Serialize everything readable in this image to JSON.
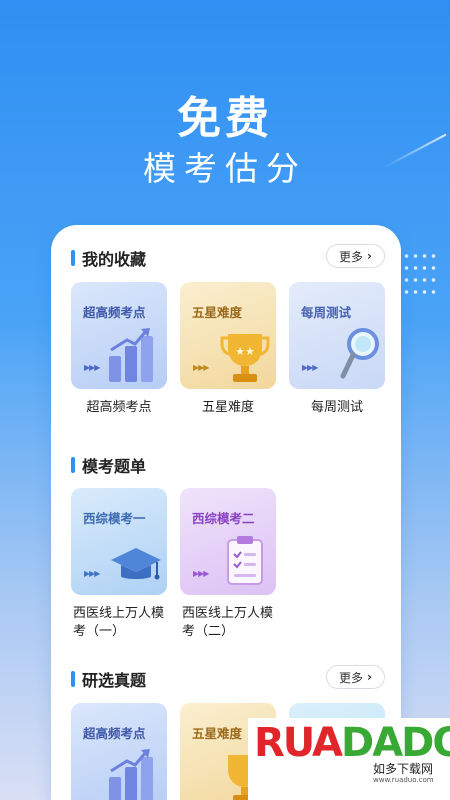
{
  "hero": {
    "title": "免费",
    "subtitle": "模考估分"
  },
  "favorites": {
    "title": "我的收藏",
    "more": "更多",
    "tiles": [
      {
        "label": "超高频考点",
        "caption": "超高频考点",
        "icon": "bar-chart-icon"
      },
      {
        "label": "五星难度",
        "caption": "五星难度",
        "icon": "trophy-icon"
      },
      {
        "label": "每周测试",
        "caption": "每周测试",
        "icon": "magnifier-icon"
      }
    ]
  },
  "mock": {
    "title": "模考题单",
    "tiles": [
      {
        "label": "西综模考一",
        "caption": "西医线上万人模考（一）",
        "icon": "graduation-cap-icon"
      },
      {
        "label": "西综模考二",
        "caption": "西医线上万人模考（二）",
        "icon": "clipboard-icon"
      }
    ]
  },
  "research": {
    "title": "研选真题",
    "more": "更多",
    "tiles": [
      {
        "label": "超高频考点",
        "icon": "bar-chart-icon"
      },
      {
        "label": "五星难度",
        "icon": "trophy-icon"
      }
    ]
  },
  "arrows": "▶▶▶",
  "watermark": {
    "logo": "RUADADO",
    "name": "如多下载网",
    "url": "www.ruaduo.com"
  }
}
